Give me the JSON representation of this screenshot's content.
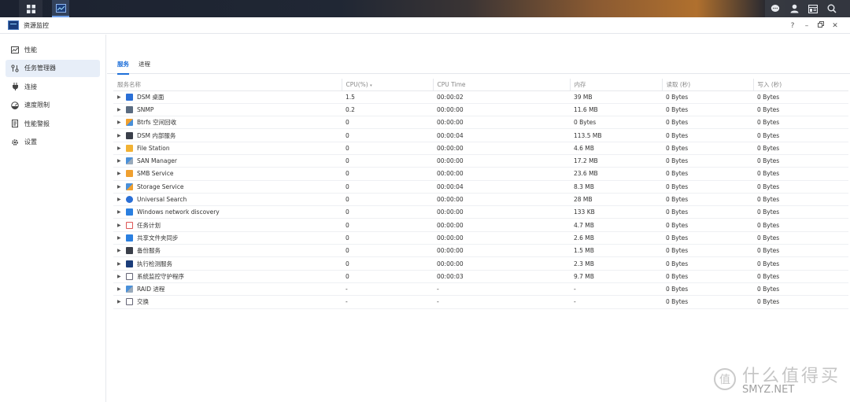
{
  "window": {
    "title": "资源监控"
  },
  "sidebar": {
    "items": [
      {
        "label": "性能",
        "icon": "performance-icon"
      },
      {
        "label": "任务管理器",
        "icon": "task-manager-icon",
        "active": true
      },
      {
        "label": "连接",
        "icon": "connection-plug-icon"
      },
      {
        "label": "速度限制",
        "icon": "speed-gauge-icon"
      },
      {
        "label": "性能警报",
        "icon": "alert-document-icon"
      },
      {
        "label": "设置",
        "icon": "gear-icon"
      }
    ]
  },
  "tabs": [
    {
      "label": "服务",
      "active": true
    },
    {
      "label": "进程",
      "active": false
    }
  ],
  "table": {
    "columns": [
      "服务名称",
      "CPU(%)",
      "CPU Time",
      "内存",
      "读取 (秒)",
      "写入 (秒)"
    ],
    "rows": [
      {
        "name": "DSM 桌面",
        "icon": "dsm-desktop-icon",
        "cpu": "1.5",
        "time": "00:00:02",
        "mem": "39 MB",
        "read": "0 Bytes",
        "write": "0 Bytes"
      },
      {
        "name": "SNMP",
        "icon": "snmp-icon",
        "cpu": "0.2",
        "time": "00:00:00",
        "mem": "11.6 MB",
        "read": "0 Bytes",
        "write": "0 Bytes"
      },
      {
        "name": "Btrfs 空间回收",
        "icon": "btrfs-icon",
        "cpu": "0",
        "time": "00:00:00",
        "mem": "0 Bytes",
        "read": "0 Bytes",
        "write": "0 Bytes"
      },
      {
        "name": "DSM 内部服务",
        "icon": "dsm-internal-icon",
        "cpu": "0",
        "time": "00:00:04",
        "mem": "113.5 MB",
        "read": "0 Bytes",
        "write": "0 Bytes"
      },
      {
        "name": "File Station",
        "icon": "file-station-icon",
        "cpu": "0",
        "time": "00:00:00",
        "mem": "4.6 MB",
        "read": "0 Bytes",
        "write": "0 Bytes"
      },
      {
        "name": "SAN Manager",
        "icon": "san-manager-icon",
        "cpu": "0",
        "time": "00:00:00",
        "mem": "17.2 MB",
        "read": "0 Bytes",
        "write": "0 Bytes"
      },
      {
        "name": "SMB Service",
        "icon": "smb-service-icon",
        "cpu": "0",
        "time": "00:00:00",
        "mem": "23.6 MB",
        "read": "0 Bytes",
        "write": "0 Bytes"
      },
      {
        "name": "Storage Service",
        "icon": "storage-service-icon",
        "cpu": "0",
        "time": "00:00:04",
        "mem": "8.3 MB",
        "read": "0 Bytes",
        "write": "0 Bytes"
      },
      {
        "name": "Universal Search",
        "icon": "universal-search-icon",
        "cpu": "0",
        "time": "00:00:00",
        "mem": "28 MB",
        "read": "0 Bytes",
        "write": "0 Bytes"
      },
      {
        "name": "Windows network discovery",
        "icon": "network-discovery-icon",
        "cpu": "0",
        "time": "00:00:00",
        "mem": "133 KB",
        "read": "0 Bytes",
        "write": "0 Bytes"
      },
      {
        "name": "任务计划",
        "icon": "task-scheduler-icon",
        "cpu": "0",
        "time": "00:00:00",
        "mem": "4.7 MB",
        "read": "0 Bytes",
        "write": "0 Bytes"
      },
      {
        "name": "共享文件夹同步",
        "icon": "shared-folder-sync-icon",
        "cpu": "0",
        "time": "00:00:00",
        "mem": "2.6 MB",
        "read": "0 Bytes",
        "write": "0 Bytes"
      },
      {
        "name": "备份服务",
        "icon": "backup-service-icon",
        "cpu": "0",
        "time": "00:00:00",
        "mem": "1.5 MB",
        "read": "0 Bytes",
        "write": "0 Bytes"
      },
      {
        "name": "执行检测服务",
        "icon": "detection-service-icon",
        "cpu": "0",
        "time": "00:00:00",
        "mem": "2.3 MB",
        "read": "0 Bytes",
        "write": "0 Bytes"
      },
      {
        "name": "系统监控守护程序",
        "icon": "system-monitor-daemon-icon",
        "cpu": "0",
        "time": "00:00:03",
        "mem": "9.7 MB",
        "read": "0 Bytes",
        "write": "0 Bytes"
      },
      {
        "name": "RAID 进程",
        "icon": "raid-icon",
        "cpu": "-",
        "time": "-",
        "mem": "-",
        "read": "0 Bytes",
        "write": "0 Bytes"
      },
      {
        "name": "交换",
        "icon": "swap-icon",
        "cpu": "-",
        "time": "-",
        "mem": "-",
        "read": "0 Bytes",
        "write": "0 Bytes"
      }
    ]
  },
  "watermark": {
    "text": "什么值得买",
    "sub": "SMYZ.NET"
  },
  "colors": {
    "accent": "#1e6fd9",
    "active_bg": "#e7eef8"
  }
}
